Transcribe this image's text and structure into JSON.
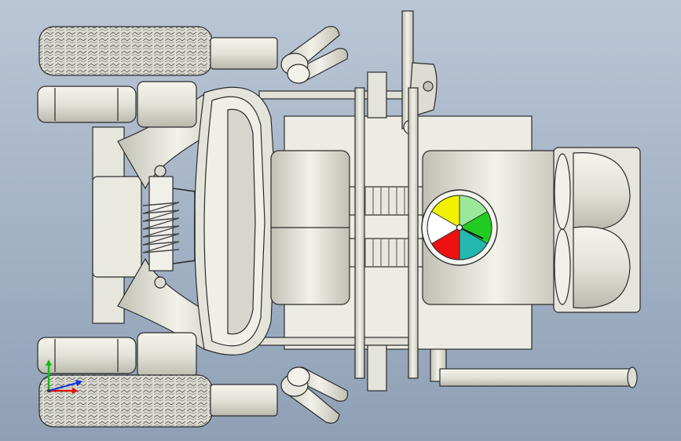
{
  "viewport": {
    "background_top": "#bac6d6",
    "background_bottom": "#8fa0b6"
  },
  "model": {
    "part_fill": "#e8e8de",
    "part_shade": "#c9c9bd",
    "edge_color": "#2b2b2b",
    "tire_fill": "#dcdcd2"
  },
  "gauge": {
    "segments": [
      {
        "name": "yellow",
        "color": "#f2f200"
      },
      {
        "name": "light-green",
        "color": "#9be89b"
      },
      {
        "name": "green",
        "color": "#22cc22"
      },
      {
        "name": "teal",
        "color": "#22b8b0"
      },
      {
        "name": "red",
        "color": "#ee1111"
      },
      {
        "name": "white",
        "color": "#ffffff"
      }
    ]
  },
  "triad": {
    "x_color": "#dd1111",
    "y_color": "#11bb11",
    "z_color": "#1133dd"
  }
}
